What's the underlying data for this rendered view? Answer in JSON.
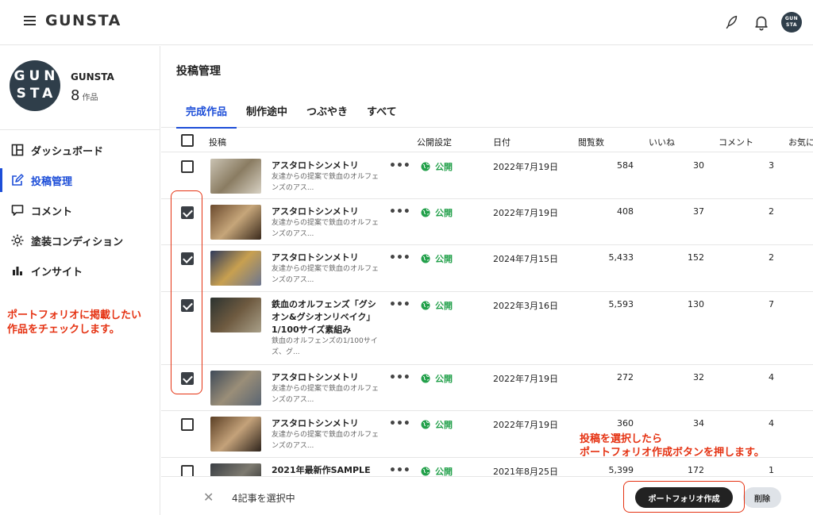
{
  "app": {
    "logo": "GUNSTA",
    "avatar_text": "GUN\nSTA"
  },
  "header_icons": [
    "menu-icon",
    "feather-icon",
    "bell-icon"
  ],
  "profile": {
    "name": "GUNSTA",
    "avatar_lines": [
      "GUN",
      "STA"
    ],
    "count": "8",
    "count_unit": "作品"
  },
  "sidebar": {
    "items": [
      {
        "label": "ダッシュボード",
        "icon": "dashboard-icon"
      },
      {
        "label": "投稿管理",
        "icon": "edit-icon",
        "active": true
      },
      {
        "label": "コメント",
        "icon": "comment-icon"
      },
      {
        "label": "塗装コンディション",
        "icon": "sun-icon"
      },
      {
        "label": "インサイト",
        "icon": "bar-chart-icon"
      }
    ]
  },
  "annotations": {
    "left": "ポートフォリオに掲載したい\n作品をチェックします。",
    "right": "投稿を選択したら\nポートフォリオ作成ボタンを押します。"
  },
  "main": {
    "title": "投稿管理",
    "tabs": [
      "完成作品",
      "制作途中",
      "つぶやき",
      "すべて"
    ],
    "active_tab": 0,
    "columns": [
      "投稿",
      "公開設定",
      "日付",
      "閲覧数",
      "いいね",
      "コメント",
      "お気に"
    ],
    "rows": [
      {
        "checked": false,
        "title": "アスタロトシンメトリ",
        "desc": "友達からの提案で鉄血のオルフェンズのアス...",
        "status": "公開",
        "date": "2022年7月19日",
        "views": "584",
        "likes": "30",
        "comments": "3"
      },
      {
        "checked": true,
        "title": "アスタロトシンメトリ",
        "desc": "友達からの提案で鉄血のオルフェンズのアス...",
        "status": "公開",
        "date": "2022年7月19日",
        "views": "408",
        "likes": "37",
        "comments": "2"
      },
      {
        "checked": true,
        "title": "アスタロトシンメトリ",
        "desc": "友達からの提案で鉄血のオルフェンズのアス...",
        "status": "公開",
        "date": "2024年7月15日",
        "views": "5,433",
        "likes": "152",
        "comments": "2"
      },
      {
        "checked": true,
        "title": "鉄血のオルフェンズ「グシオン&グシオンリベイク」1/100サイズ素組み",
        "desc": "鉄血のオルフェンズの1/100サイズ、グ...",
        "status": "公開",
        "date": "2022年3月16日",
        "views": "5,593",
        "likes": "130",
        "comments": "7"
      },
      {
        "checked": true,
        "title": "アスタロトシンメトリ",
        "desc": "友達からの提案で鉄血のオルフェンズのアス...",
        "status": "公開",
        "date": "2022年7月19日",
        "views": "272",
        "likes": "32",
        "comments": "4"
      },
      {
        "checked": false,
        "title": "アスタロトシンメトリ",
        "desc": "友達からの提案で鉄血のオルフェンズのアス...",
        "status": "公開",
        "date": "2022年7月19日",
        "views": "360",
        "likes": "34",
        "comments": "4"
      },
      {
        "checked": false,
        "title": "2021年最新作SAMPLE",
        "desc": "",
        "status": "公開",
        "date": "2021年8月25日",
        "views": "5,399",
        "likes": "172",
        "comments": "1"
      }
    ]
  },
  "bottombar": {
    "selected_text": "4記事を選択中",
    "portfolio_button": "ポートフォリオ作成",
    "delete_button": "削除"
  },
  "colors": {
    "accent": "#1d4ed8",
    "public_green": "#22a04a",
    "annotation_red": "#e53212",
    "avatar_bg": "#2f3e4a"
  }
}
